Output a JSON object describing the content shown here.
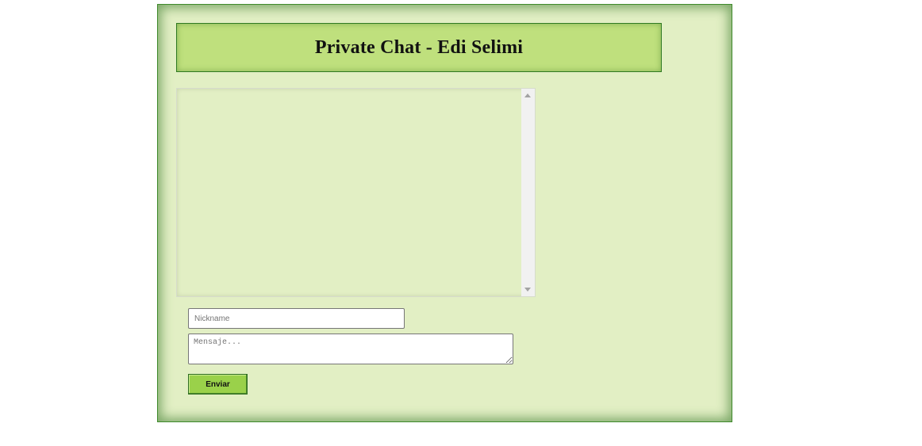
{
  "header": {
    "title": "Private Chat - Edi Selimi"
  },
  "chat": {
    "messages": []
  },
  "form": {
    "nickname_placeholder": "Nickname",
    "nickname_value": "",
    "message_placeholder": "Mensaje...",
    "message_value": "",
    "send_label": "Enviar"
  },
  "colors": {
    "panel_background": "#e2efc4",
    "header_background": "#bfe07d",
    "border_green": "#2f7a22",
    "button_green": "#9ad14a"
  }
}
